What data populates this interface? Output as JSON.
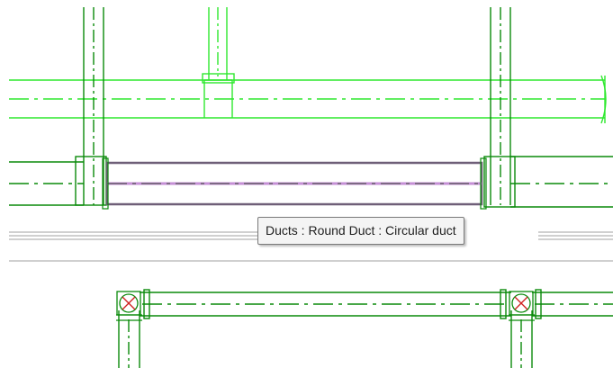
{
  "tooltip": {
    "text": "Ducts : Round Duct : Circular duct"
  },
  "colors": {
    "bright_duct": "#2ee82e",
    "dark_duct": "#0a8a0a",
    "selected_outline": "#6f5f78",
    "selected_center": "#c58fd6",
    "tooltip_bg": "#f4f4f4",
    "tooltip_border": "#7a7a7a",
    "wall_line": "#a0a0a0",
    "fitting_red": "#d02020"
  },
  "elements": [
    "bright-horizontal-duct",
    "selected-round-duct",
    "lower-horizontal-duct",
    "vertical-ducts",
    "elbow-fittings"
  ]
}
